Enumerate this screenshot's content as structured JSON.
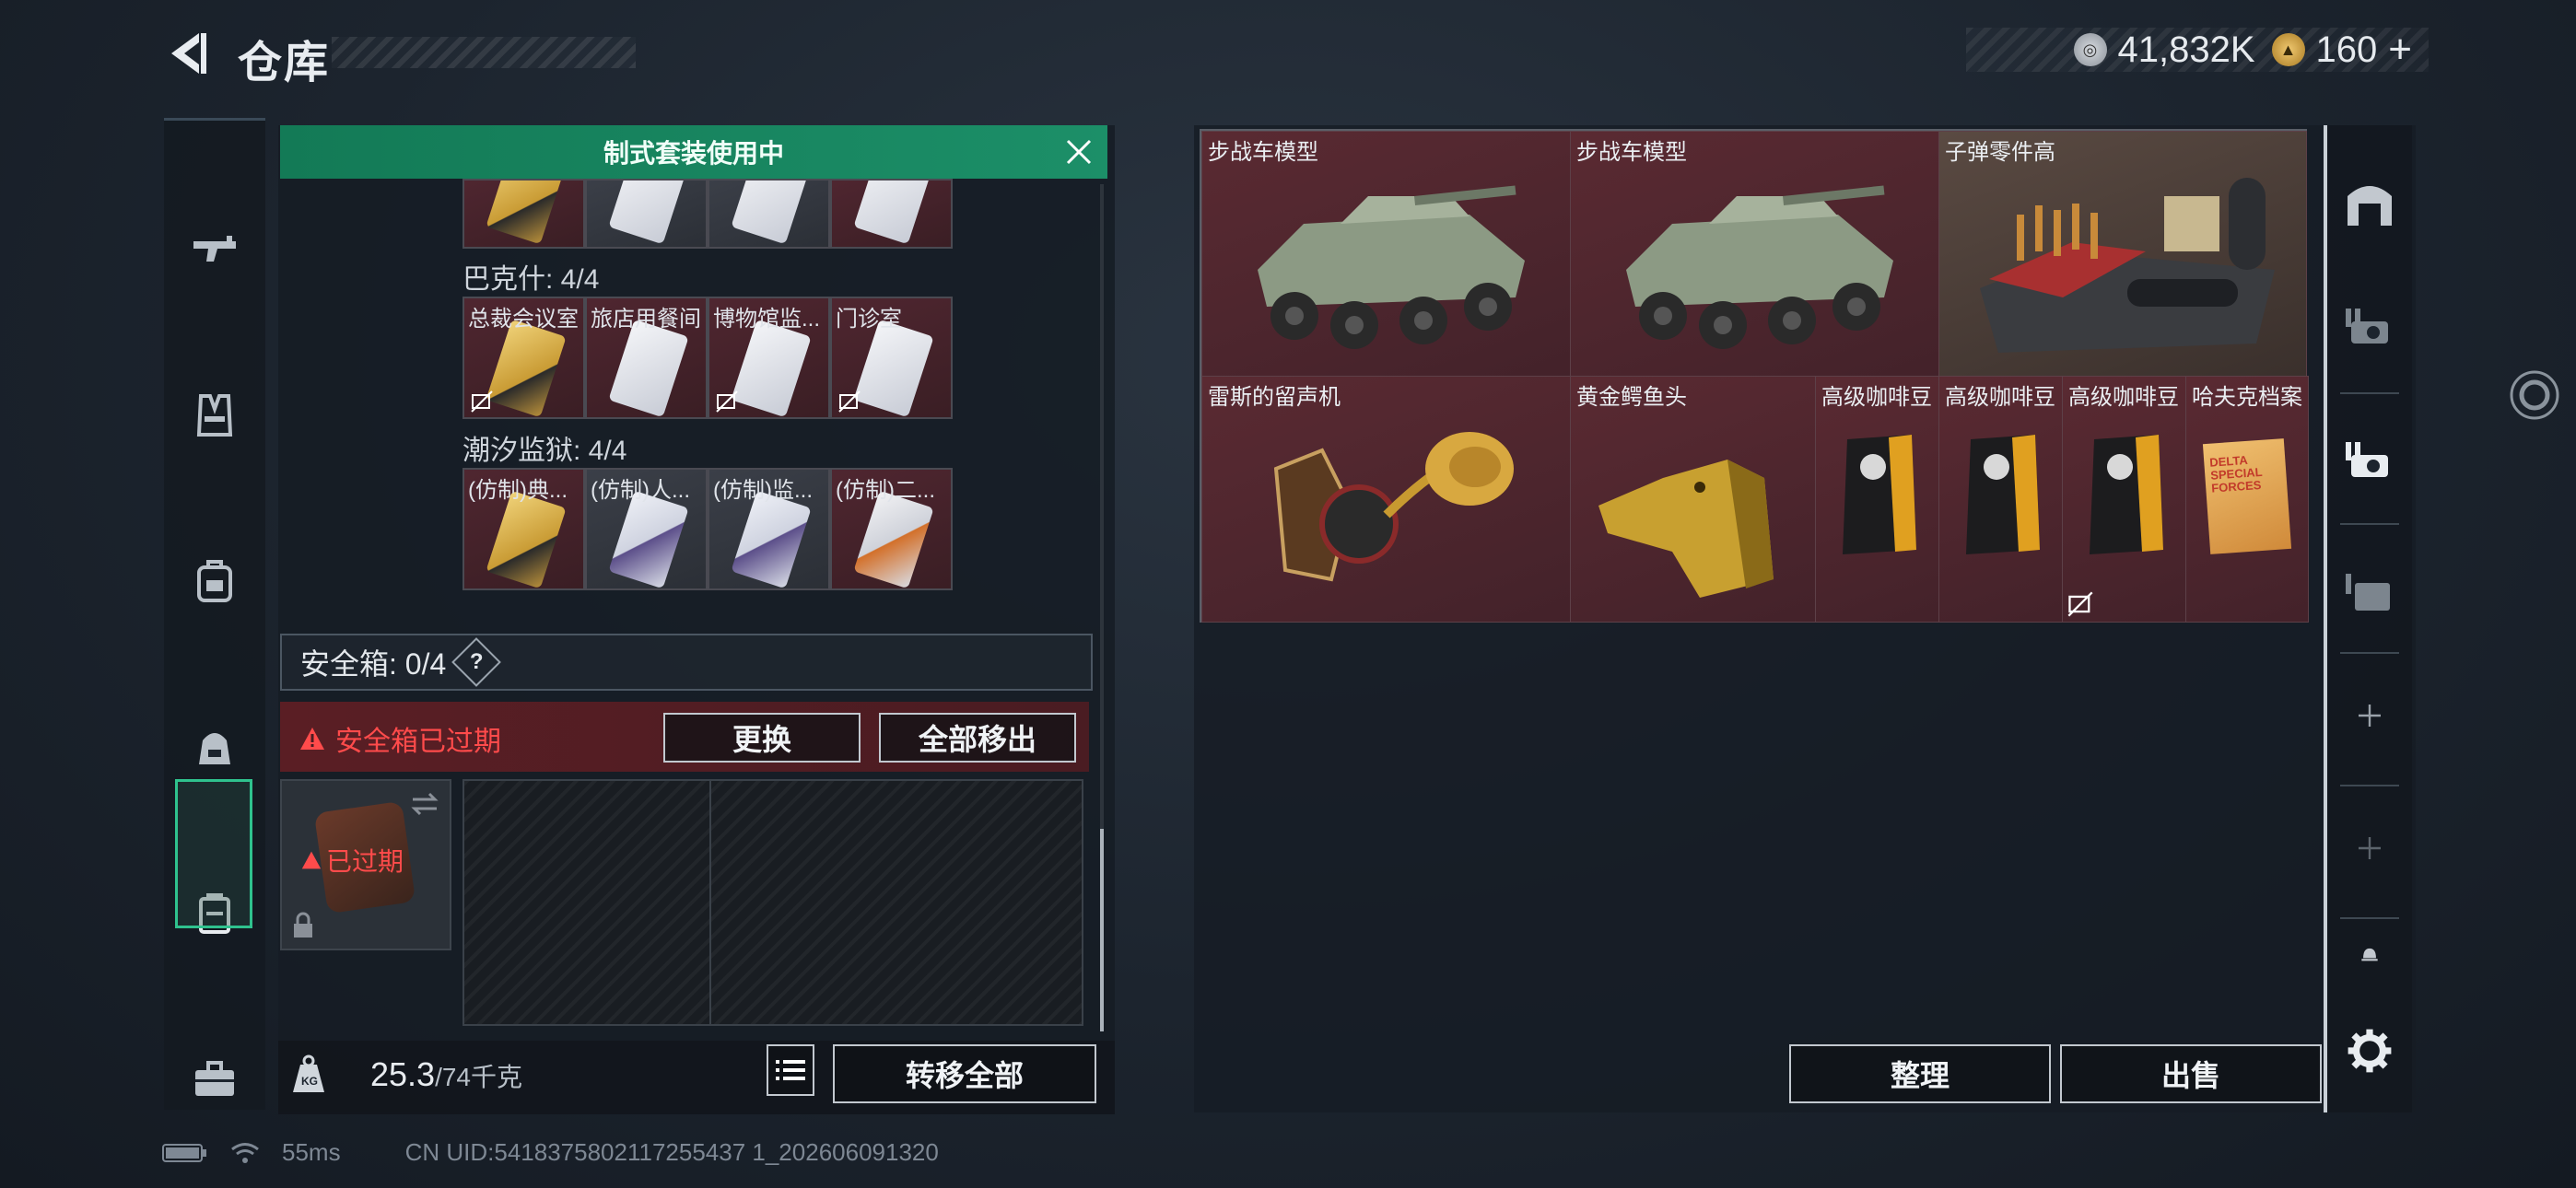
{
  "header": {
    "title": "仓库",
    "currency": [
      {
        "value": "41,832K",
        "icon": "silver-coin-icon",
        "color": "#c5cbd2"
      },
      {
        "value": "160",
        "icon": "gold-coin-icon",
        "color": "#d9a84a",
        "suffix": "+"
      }
    ]
  },
  "left_nav": {
    "items": [
      "weapon-icon",
      "armor-vest-icon",
      "backpack-icon",
      "chest-rig-icon",
      "safe-case-icon",
      "toolbox-icon"
    ],
    "active_index": 4
  },
  "loadout": {
    "banner": "制式套装使用中",
    "sets": [
      {
        "label": "巴克什: 4/4",
        "cards": [
          {
            "name": "总裁会议室",
            "color": "red",
            "art": "gold",
            "no_trade": true
          },
          {
            "name": "旅店用餐间",
            "color": "red",
            "art": "white",
            "no_trade": false
          },
          {
            "name": "博物馆监...",
            "color": "red",
            "art": "white",
            "no_trade": true
          },
          {
            "name": "门诊室",
            "color": "red",
            "art": "white",
            "no_trade": true
          }
        ]
      },
      {
        "label": "潮汐监狱: 4/4",
        "cards": [
          {
            "name": "(仿制)典...",
            "color": "red",
            "art": "gold",
            "no_trade": false
          },
          {
            "name": "(仿制)人...",
            "color": "gray",
            "art": "purple",
            "no_trade": false
          },
          {
            "name": "(仿制)监...",
            "color": "gray",
            "art": "purple",
            "no_trade": false
          },
          {
            "name": "(仿制)二...",
            "color": "red",
            "art": "orange",
            "no_trade": false
          }
        ]
      }
    ],
    "safebox": {
      "label": "安全箱: 0/4",
      "help": "?",
      "expired_warning": "安全箱已过期",
      "replace_button": "更换",
      "remove_all_button": "全部移出",
      "item_status": "已过期"
    },
    "weight": {
      "current": "25.3",
      "max": "/74千克"
    },
    "transfer_all_button": "转移全部"
  },
  "stash": {
    "items": [
      {
        "name": "步战车模型",
        "art": "apc"
      },
      {
        "name": "步战车模型",
        "art": "apc"
      },
      {
        "name": "子弹零件高",
        "art": "ammo-crate"
      },
      {
        "name": "雷斯的留声机",
        "art": "gramophone"
      },
      {
        "name": "黄金鳄鱼头",
        "art": "gold-croc"
      },
      {
        "name": "高级咖啡豆",
        "art": "coffee"
      },
      {
        "name": "高级咖啡豆",
        "art": "coffee"
      },
      {
        "name": "高级咖啡豆",
        "art": "coffee",
        "no_trade": true
      },
      {
        "name": "哈夫克档案",
        "art": "folder"
      }
    ],
    "folder_text": "DELTA SPECIAL FORCES",
    "sort_button": "整理",
    "sell_button": "出售"
  },
  "right_tools": [
    "warehouse-tab-icon",
    "camera-stash-icon",
    "camera-stash-active-icon",
    "stash-folder-icon",
    "add-icon",
    "add-icon",
    "bell-icon",
    "settings-icon"
  ],
  "status_bar": {
    "ping": "55ms",
    "uid": "CN UID:5418375802117255437 1_202606091320"
  }
}
